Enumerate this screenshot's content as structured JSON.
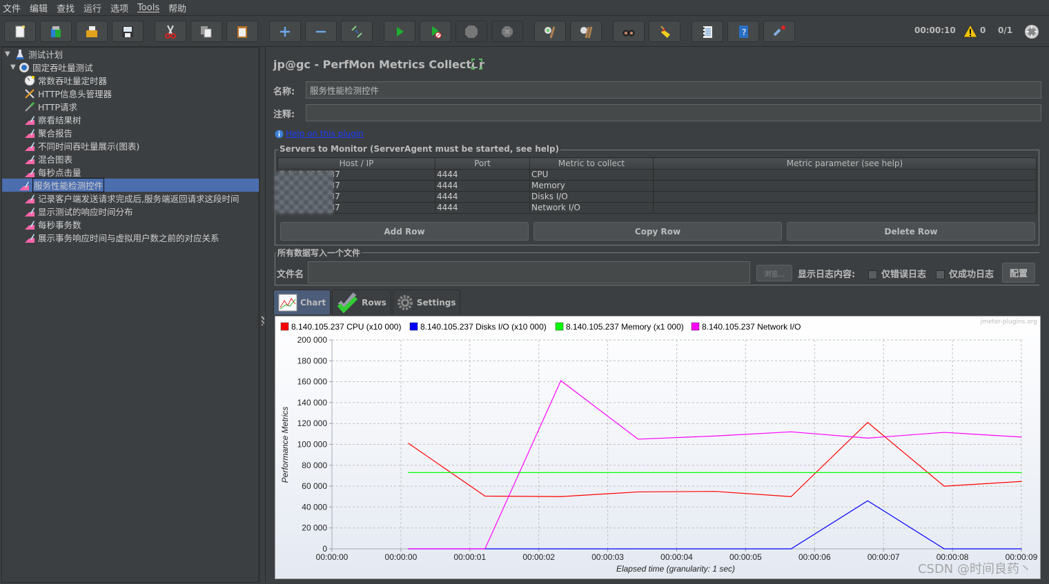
{
  "menu": [
    "文件",
    "编辑",
    "查找",
    "运行",
    "选项",
    "Tools",
    "帮助"
  ],
  "toolbar": {
    "buttons": [
      "new-icon",
      "templates-icon",
      "open-icon",
      "save-icon",
      "cut-icon",
      "copy-icon",
      "paste-icon",
      "expand-icon",
      "collapse-icon",
      "toggle-icon",
      "start-icon",
      "start-no-pause-icon",
      "stop-icon",
      "shutdown-icon",
      "clear-icon",
      "clear-all-icon",
      "search-icon",
      "reset-search-icon",
      "function-helper-icon",
      "help-icon",
      "remote-icon"
    ],
    "timer": "00:00:10",
    "warnings": "0",
    "threads": "0/1"
  },
  "tree": {
    "root": "测试计划",
    "group": "固定吞吐量测试",
    "items": [
      {
        "label": "常数吞吐量定时器",
        "icon": "timer-icon"
      },
      {
        "label": "HTTP信息头管理器",
        "icon": "tools-icon"
      },
      {
        "label": "HTTP请求",
        "icon": "pipette-icon"
      },
      {
        "label": "察看结果树",
        "icon": "listener-icon"
      },
      {
        "label": "聚合报告",
        "icon": "listener-icon"
      },
      {
        "label": "不同时间吞吐量展示(图表)",
        "icon": "listener-icon"
      },
      {
        "label": "混合图表",
        "icon": "listener-icon"
      },
      {
        "label": "每秒点击量",
        "icon": "listener-icon"
      },
      {
        "label": "服务性能检测控件",
        "icon": "listener-icon",
        "selected": true
      },
      {
        "label": "记录客户端发送请求完成后,服务端返回请求这段时间",
        "icon": "listener-icon"
      },
      {
        "label": "显示测试的响应时间分布",
        "icon": "listener-icon"
      },
      {
        "label": "每秒事务数",
        "icon": "listener-icon"
      },
      {
        "label": "展示事务响应时间与虚拟用户数之前的对应关系",
        "icon": "listener-icon"
      }
    ]
  },
  "main": {
    "title": "jp@gc - PerfMon Metrics Collector",
    "name_label": "名称:",
    "name_value": "服务性能检测控件",
    "comment_label": "注释:",
    "comment_value": "",
    "help_link": "Help on this plugin",
    "servers_group": "Servers to Monitor (ServerAgent must be started, see help)",
    "columns": [
      "Host / IP",
      "Port",
      "Metric to collect",
      "Metric parameter (see help)"
    ],
    "rows": [
      {
        "host": "8.140.105.237",
        "port": "4444",
        "metric": "CPU",
        "param": ""
      },
      {
        "host": "8.140.105.237",
        "port": "4444",
        "metric": "Memory",
        "param": ""
      },
      {
        "host": "8.140.105.237",
        "port": "4444",
        "metric": "Disks I/O",
        "param": ""
      },
      {
        "host": "8.140.105.237",
        "port": "4444",
        "metric": "Network I/O",
        "param": ""
      }
    ],
    "add_row": "Add Row",
    "copy_row": "Copy Row",
    "delete_row": "Delete Row",
    "file_group": "所有数据写入一个文件",
    "file_label": "文件名",
    "file_value": "",
    "browse": "浏览...",
    "log_label": "显示日志内容:",
    "errors_only": "仅错误日志",
    "success_only": "仅成功日志",
    "configure": "配置",
    "tabs": [
      {
        "label": "Chart",
        "icon": "chart-icon",
        "active": true
      },
      {
        "label": "Rows",
        "icon": "checkmark-icon"
      },
      {
        "label": "Settings",
        "icon": "gear-icon"
      }
    ]
  },
  "chart_data": {
    "type": "line",
    "title": "",
    "watermark": "jmeter-plugins.org",
    "xlabel": "Elapsed time (granularity: 1 sec)",
    "ylabel": "Performance Metrics",
    "x_ticks": [
      "00:00:00",
      "00:00:00",
      "00:00:01",
      "00:00:02",
      "00:00:03",
      "00:00:04",
      "00:00:05",
      "00:00:06",
      "00:00:07",
      "00:00:08",
      "00:00:09"
    ],
    "y_ticks": [
      "0",
      "20 000",
      "40 000",
      "60 000",
      "80 000",
      "100 000",
      "120 000",
      "140 000",
      "160 000",
      "180 000",
      "200 000"
    ],
    "ylim": [
      0,
      200000
    ],
    "xlim": [
      0,
      10
    ],
    "grid": true,
    "legend_position": "top",
    "x": [
      1.11,
      2.22,
      3.32,
      4.44,
      5.55,
      6.66,
      7.77,
      8.88,
      10.0
    ],
    "series": [
      {
        "name": "8.140.105.237 CPU (x10 000)",
        "color": "#ff0000",
        "values": [
          101000,
          50500,
          50000,
          54500,
          55000,
          50000,
          121000,
          60000,
          64500
        ]
      },
      {
        "name": "8.140.105.237 Disks I/O (x10 000)",
        "color": "#0000ff",
        "values": [
          0,
          0,
          0,
          0,
          0,
          0,
          46000,
          0,
          0
        ]
      },
      {
        "name": "8.140.105.237 Memory (x1 000)",
        "color": "#00ff00",
        "values": [
          73000,
          73000,
          73000,
          73000,
          73000,
          73000,
          73000,
          73000,
          73000
        ]
      },
      {
        "name": "8.140.105.237 Network I/O",
        "color": "#ff00ff",
        "values": [
          0,
          0,
          161000,
          105000,
          108000,
          112000,
          106000,
          111500,
          107000
        ]
      }
    ]
  },
  "footer_watermark": "CSDN @时间良药丶"
}
